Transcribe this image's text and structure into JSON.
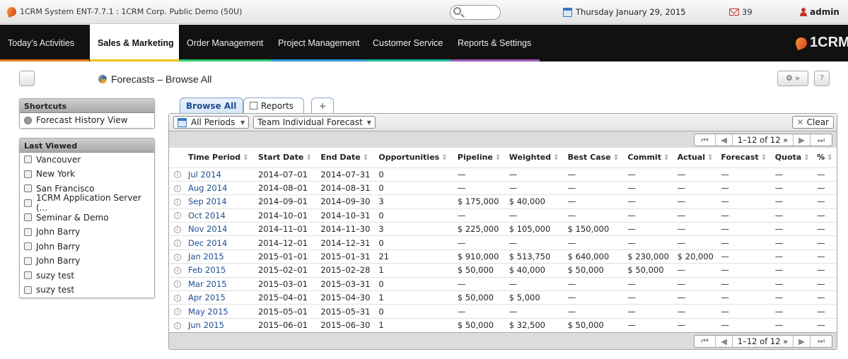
{
  "system": {
    "title": "1CRM System ENT-7.7.1 : 1CRM Corp. Public Demo (50U)",
    "date": "Thursday January 29, 2015",
    "mail_count": "39",
    "user": "admin"
  },
  "nav": {
    "tabs": [
      {
        "label": "Today's Activities",
        "color": "#e67e22"
      },
      {
        "label": "Sales & Marketing",
        "color": "#f1c40f"
      },
      {
        "label": "Order Management",
        "color": "#2ecc71"
      },
      {
        "label": "Project Management",
        "color": "#3498db"
      },
      {
        "label": "Customer Service",
        "color": "#1abc9c"
      },
      {
        "label": "Reports & Settings",
        "color": "#9b59b6"
      }
    ],
    "brand": "1CRM"
  },
  "page": {
    "title": "Forecasts – Browse All"
  },
  "shortcuts": {
    "header": "Shortcuts",
    "items": [
      "Forecast History View"
    ]
  },
  "last_viewed": {
    "header": "Last Viewed",
    "items": [
      "Vancouver",
      "New York",
      "San Francisco",
      "1CRM Application Server (...",
      "Seminar & Demo",
      "John Barry",
      "John Barry",
      "John Barry",
      "suzy test",
      "suzy test"
    ]
  },
  "tabs": {
    "browse": "Browse All",
    "reports": "Reports"
  },
  "filters": {
    "period": "All Periods",
    "forecast": "Team Individual Forecast",
    "clear": "Clear"
  },
  "pager": {
    "range": "1–12 of 12"
  },
  "table": {
    "headers": [
      "Time Period",
      "Start Date",
      "End Date",
      "Opportunities",
      "Pipeline",
      "Weighted",
      "Best Case",
      "Commit",
      "Actual",
      "Forecast",
      "Quota",
      "%"
    ],
    "rows": [
      [
        "Jul 2014",
        "2014–07–01",
        "2014–07–31",
        "0",
        "—",
        "—",
        "—",
        "—",
        "—",
        "—",
        "—",
        "—"
      ],
      [
        "Aug 2014",
        "2014–08–01",
        "2014–08–31",
        "0",
        "—",
        "—",
        "—",
        "—",
        "—",
        "—",
        "—",
        "—"
      ],
      [
        "Sep 2014",
        "2014–09–01",
        "2014–09–30",
        "3",
        "$ 175,000",
        "$ 40,000",
        "—",
        "—",
        "—",
        "—",
        "—",
        "—"
      ],
      [
        "Oct 2014",
        "2014–10–01",
        "2014–10–31",
        "0",
        "—",
        "—",
        "—",
        "—",
        "—",
        "—",
        "—",
        "—"
      ],
      [
        "Nov 2014",
        "2014–11–01",
        "2014–11–30",
        "3",
        "$ 225,000",
        "$ 105,000",
        "$ 150,000",
        "—",
        "—",
        "—",
        "—",
        "—"
      ],
      [
        "Dec 2014",
        "2014–12–01",
        "2014–12–31",
        "0",
        "—",
        "—",
        "—",
        "—",
        "—",
        "—",
        "—",
        "—"
      ],
      [
        "Jan 2015",
        "2015–01–01",
        "2015–01–31",
        "21",
        "$ 910,000",
        "$ 513,750",
        "$ 640,000",
        "$ 230,000",
        "$ 20,000",
        "—",
        "—",
        "—"
      ],
      [
        "Feb 2015",
        "2015–02–01",
        "2015–02–28",
        "1",
        "$ 50,000",
        "$ 40,000",
        "$ 50,000",
        "$ 50,000",
        "—",
        "—",
        "—",
        "—"
      ],
      [
        "Mar 2015",
        "2015–03–01",
        "2015–03–31",
        "0",
        "—",
        "—",
        "—",
        "—",
        "—",
        "—",
        "—",
        "—"
      ],
      [
        "Apr 2015",
        "2015–04–01",
        "2015–04–30",
        "1",
        "$ 50,000",
        "$ 5,000",
        "—",
        "—",
        "—",
        "—",
        "—",
        "—"
      ],
      [
        "May 2015",
        "2015–05–01",
        "2015–05–31",
        "0",
        "—",
        "—",
        "—",
        "—",
        "—",
        "—",
        "—",
        "—"
      ],
      [
        "Jun 2015",
        "2015–06–01",
        "2015–06–30",
        "1",
        "$ 50,000",
        "$ 32,500",
        "$ 50,000",
        "—",
        "—",
        "—",
        "—",
        "—"
      ]
    ]
  }
}
